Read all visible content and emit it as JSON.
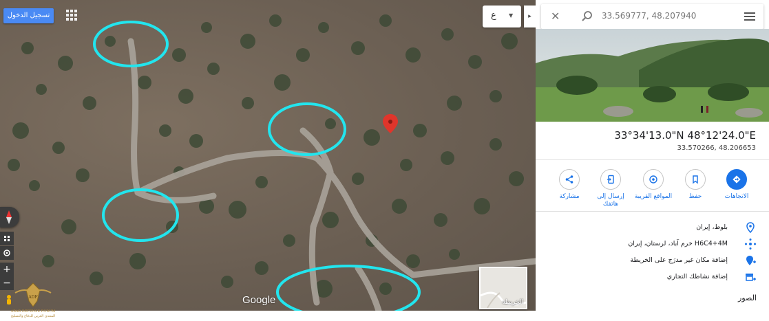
{
  "map": {
    "signin_label": "تسجيل الدخول",
    "language_value": "ع",
    "google_logo": "Google",
    "layers_label": "الخريطة",
    "zoom_in": "+",
    "zoom_out": "−",
    "watermark_title": "ARAB DEFENSE FORUM",
    "watermark_subtitle": "المنتدى العربي للدفاع والتسليح",
    "pin_color": "#e0352b",
    "annotation_color": "#22e5ee"
  },
  "panel": {
    "search": {
      "value": "33.569777, 48.207940"
    },
    "coordinates_dms": "33°34'13.0\"N 48°12'24.0\"E",
    "coordinates_decimal": "33.570266, 48.206653",
    "actions": [
      {
        "icon": "directions-icon",
        "label": "الاتجاهات"
      },
      {
        "icon": "bookmark-icon",
        "label": "حفظ"
      },
      {
        "icon": "nearby-icon",
        "label": "المواقع القريبة"
      },
      {
        "icon": "send-to-phone-icon",
        "label": "إرسال إلى هاتفك"
      },
      {
        "icon": "share-icon",
        "label": "مشاركة"
      }
    ],
    "info": [
      {
        "icon": "location-pin-icon",
        "text": "بلوط، إيران"
      },
      {
        "icon": "plus-code-icon",
        "text": "H6C4+4M خرم آباد، لرستان، إيران"
      },
      {
        "icon": "add-place-icon",
        "text": "إضافة مكان غير مدرَج على الخريطة"
      },
      {
        "icon": "add-business-icon",
        "text": "إضافة نشاطك التجاري"
      }
    ],
    "photos_heading": "الصور"
  }
}
